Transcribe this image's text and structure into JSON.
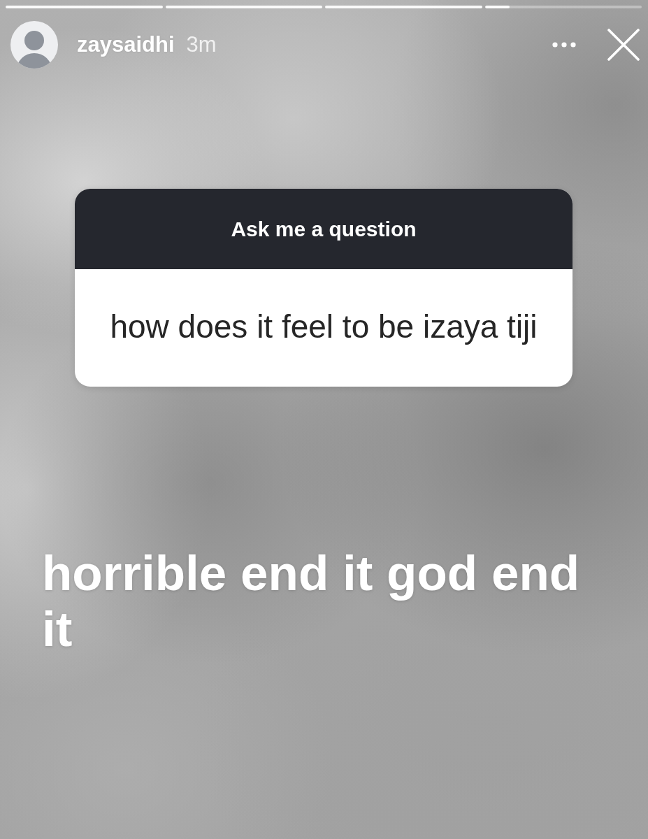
{
  "progress": [
    {
      "seen": true
    },
    {
      "seen": true
    },
    {
      "seen": true
    },
    {
      "seen": false,
      "level": 0.16
    }
  ],
  "header": {
    "username": "zaysaidhi",
    "time": "3m"
  },
  "question_sticker": {
    "title": "Ask me a question",
    "question": "how does it feel to be izaya tiji"
  },
  "caption": "horrible end it god end it"
}
